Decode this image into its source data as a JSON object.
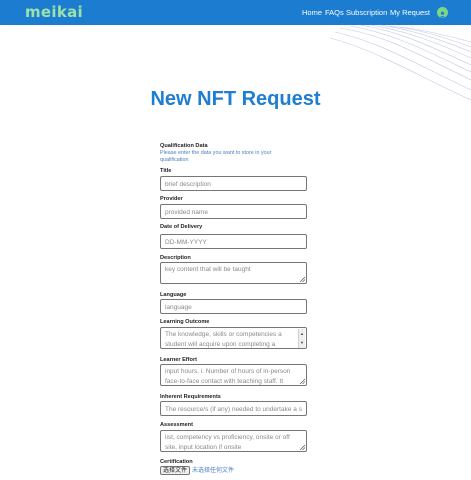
{
  "brand": {
    "logo_text": "meikai",
    "nav_color": "#1c7ccf",
    "logo_color": "#9be3a9",
    "title_color": "#1e7ed4"
  },
  "nav": {
    "items": [
      {
        "label": "Home"
      },
      {
        "label": "FAQs"
      },
      {
        "label": "Subscription"
      },
      {
        "label": "My Request"
      }
    ],
    "avatar_icon": "user-avatar-icon"
  },
  "page": {
    "title": "New NFT Request"
  },
  "form": {
    "section_title": "Qualification Data",
    "section_desc": "Please enter the data you want to store in your qualification",
    "fields": [
      {
        "label": "Title",
        "placeholder": "brief description"
      },
      {
        "label": "Provider",
        "placeholder": "provided name"
      },
      {
        "label": "Date of Delivery",
        "placeholder": "DD-MM-YYYY"
      },
      {
        "label": "Description",
        "placeholder": "key content that will be taught"
      },
      {
        "label": "Language",
        "placeholder": "language"
      },
      {
        "label": "Learning Outcome",
        "placeholder": "The knowledge, skills or competencies a student will acquire upon completing a"
      },
      {
        "label": "Learner Effort",
        "placeholder": "input hours, i. Number of hours of in-person face-to-face contact with teaching staff. It also...of learning"
      },
      {
        "label": "Inherent Requirements",
        "placeholder": "The resource/s (if any) needed to undertake a s"
      },
      {
        "label": "Assessment",
        "placeholder": "list, competency vs proficiency, onsite or off site, input location if onsite"
      },
      {
        "label": "Certification",
        "file_button": "选择文件",
        "file_status": "未选择任何文件"
      }
    ]
  }
}
